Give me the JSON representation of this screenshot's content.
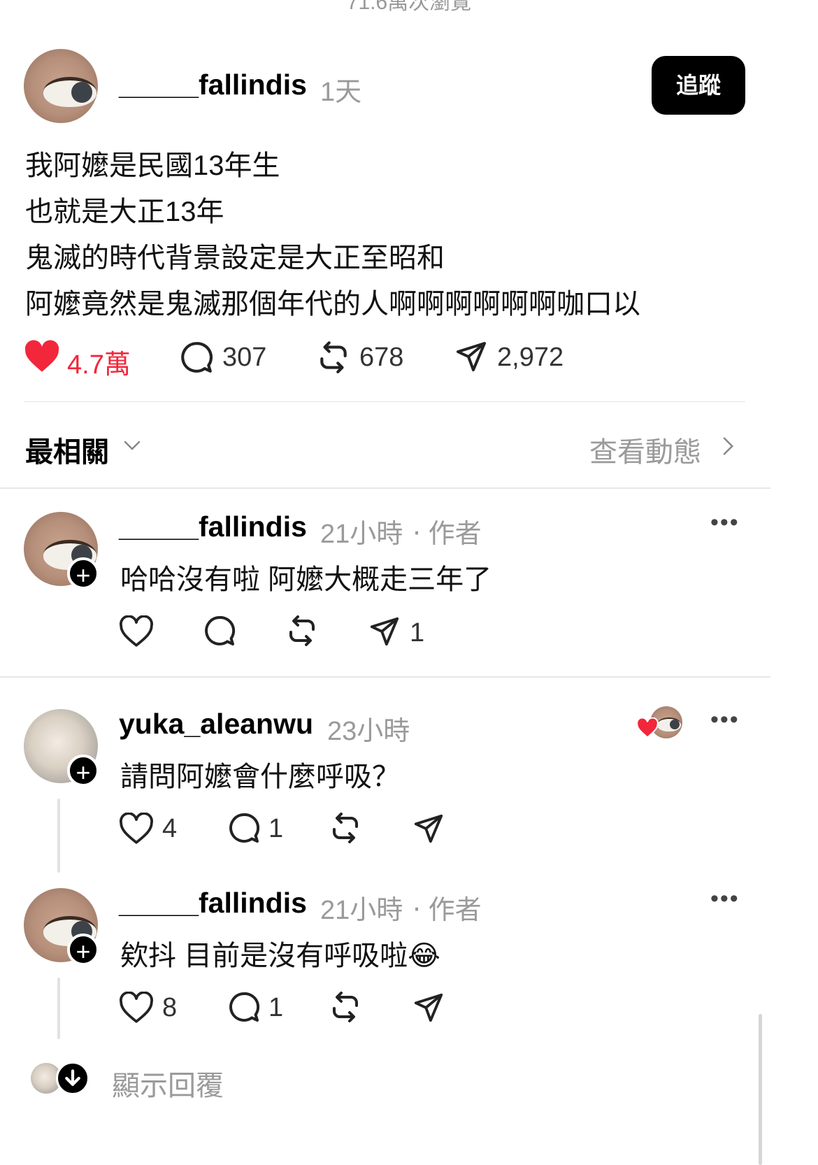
{
  "top_cut_text": "71.6萬次瀏覽",
  "post": {
    "username": "_____fallindis",
    "time": "1天",
    "follow_label": "追蹤",
    "lines": [
      "我阿嬤是民國13年生",
      "也就是大正13年",
      "鬼滅的時代背景設定是大正至昭和",
      "阿嬤竟然是鬼滅那個年代的人啊啊啊啊啊啊咖口以"
    ],
    "likes": "4.7萬",
    "comments": "307",
    "reposts": "678",
    "shares": "2,972"
  },
  "sort": {
    "label": "最相關",
    "view_activity": "查看動態"
  },
  "replies": [
    {
      "username": "_____fallindis",
      "time": "21小時",
      "author_tag": "‧ 作者",
      "text": "哈哈沒有啦 阿嬤大概走三年了",
      "likes": "",
      "comments": "",
      "shares": "1"
    },
    {
      "username": "yuka_aleanwu",
      "time": "23小時",
      "text": "請問阿嬤會什麼呼吸？",
      "likes": "4",
      "comments": "1"
    },
    {
      "username": "_____fallindis",
      "time": "21小時",
      "author_tag": "‧ 作者",
      "text": "欸抖 目前是沒有呼吸啦",
      "emoji": "😂",
      "likes": "8",
      "comments": "1"
    }
  ],
  "show_replies": "顯示回覆",
  "colors": {
    "like_red": "#f2273b",
    "muted": "#9a9a9a",
    "divider": "#e2e2e2"
  },
  "icons": [
    "heart-icon",
    "comment-icon",
    "repost-icon",
    "share-icon",
    "chevron-down-icon",
    "chevron-right-icon",
    "more-icon",
    "plus-icon",
    "arrow-down-icon"
  ]
}
